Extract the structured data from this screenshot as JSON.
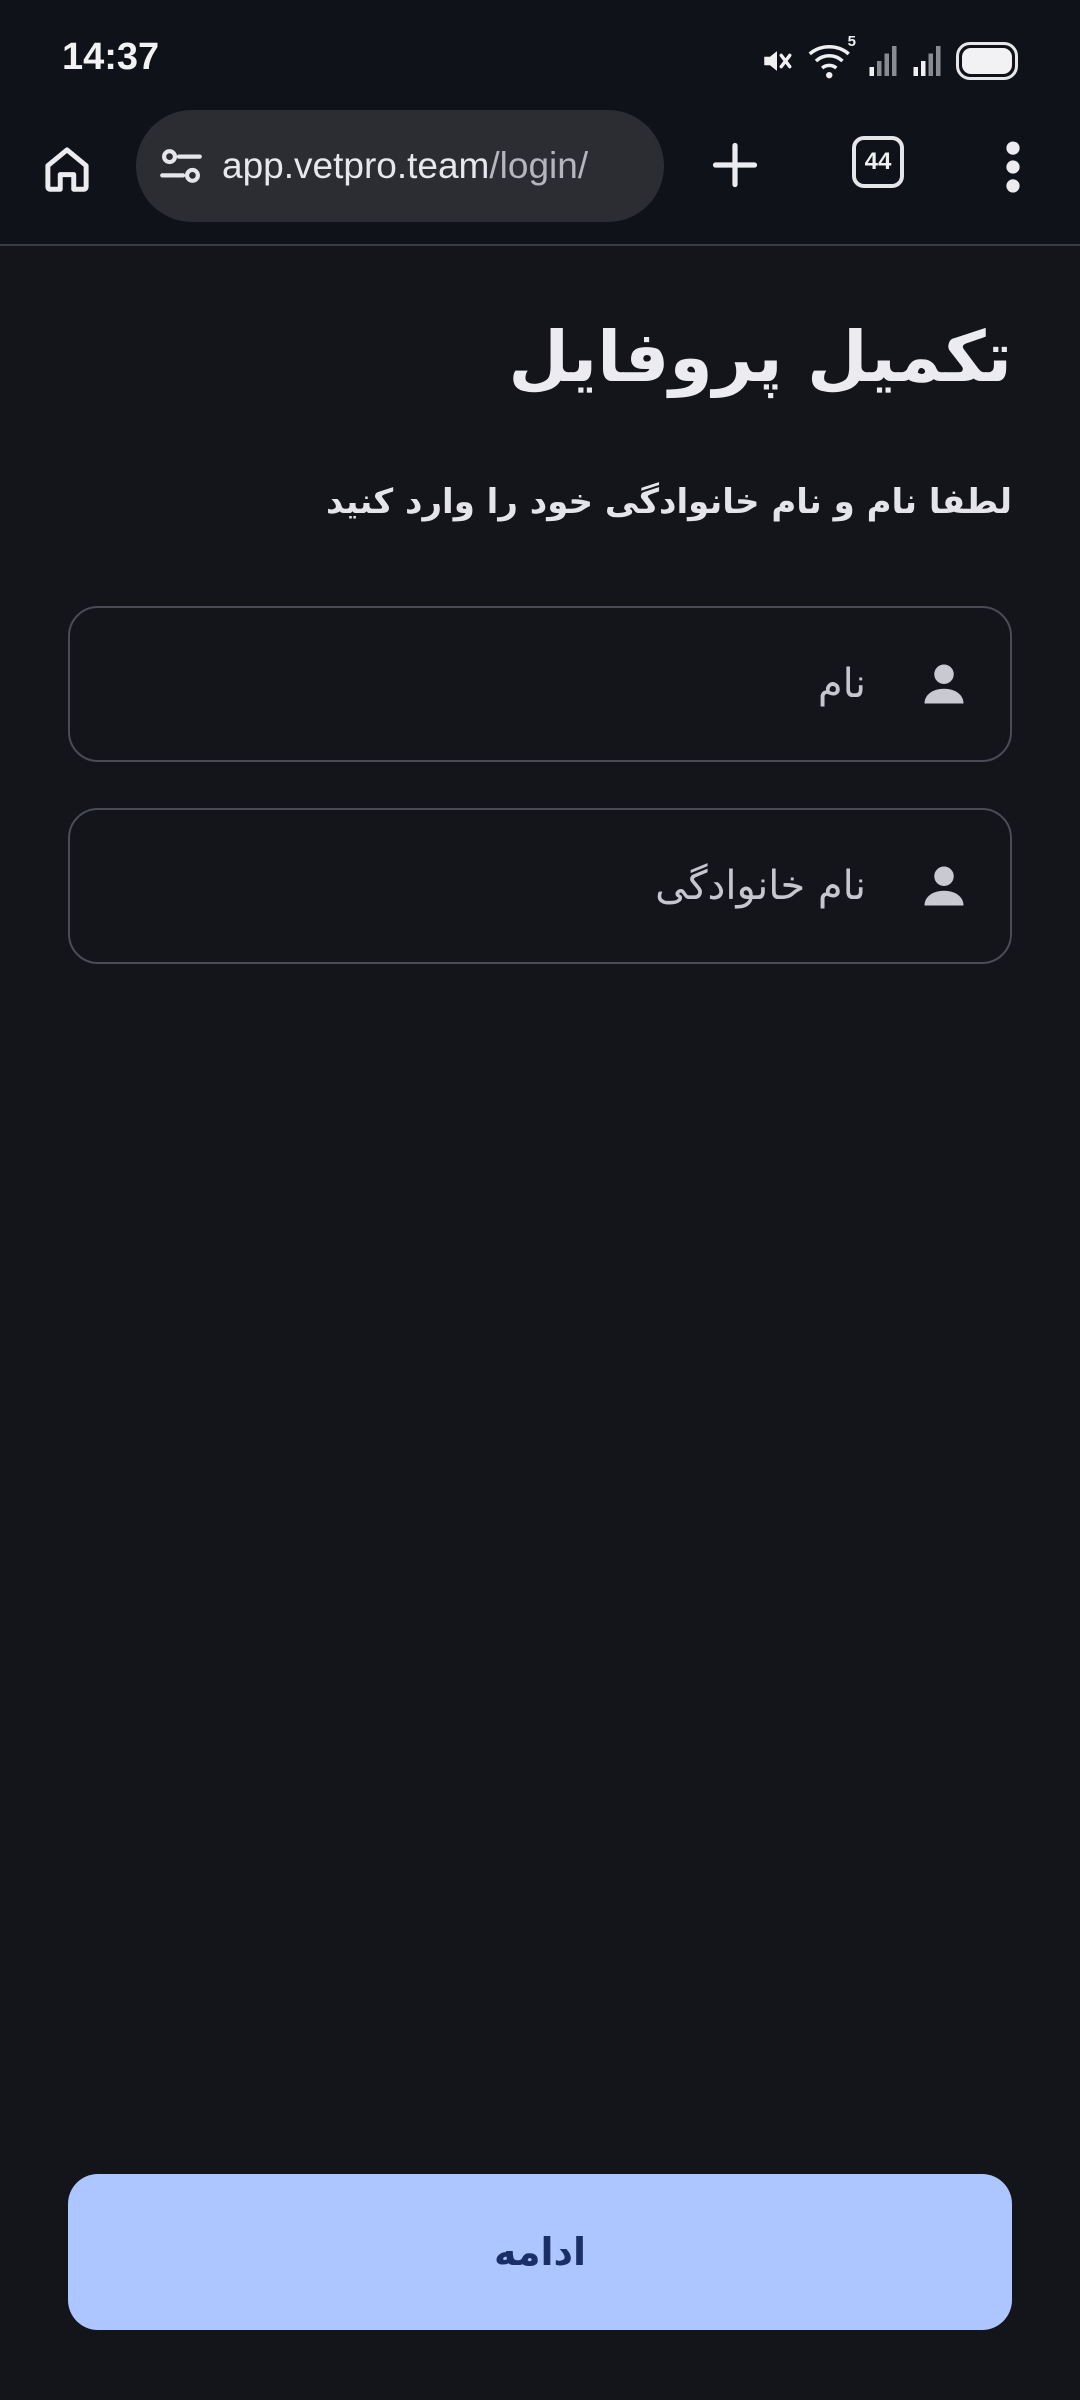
{
  "status_bar": {
    "time": "14:37",
    "icons": [
      "mute-icon",
      "wifi-icon",
      "signal-icon",
      "signal-icon",
      "battery-icon"
    ],
    "wifi_badge": "5"
  },
  "browser": {
    "url_host": "app.vetpro.team",
    "url_path": "/login/",
    "tab_count": "44",
    "icons": [
      "home-icon",
      "site-settings-icon",
      "plus-icon",
      "tab-switcher-icon",
      "more-vert-icon"
    ]
  },
  "form": {
    "title": "تکمیل پروفایل",
    "subtitle": "لطفا نام و نام خانوادگی خود را وارد کنید",
    "first_name": {
      "placeholder": "نام",
      "value": ""
    },
    "last_name": {
      "placeholder": "نام خانوادگی",
      "value": ""
    },
    "field_icon": "person-icon",
    "continue_label": "ادامه"
  },
  "colors": {
    "background": "#14151b",
    "chrome": "#0f1218",
    "url_bar": "#2b2d33",
    "field_border": "#4a4c55",
    "button": "#adc6ff",
    "button_text": "#1a2f66"
  }
}
